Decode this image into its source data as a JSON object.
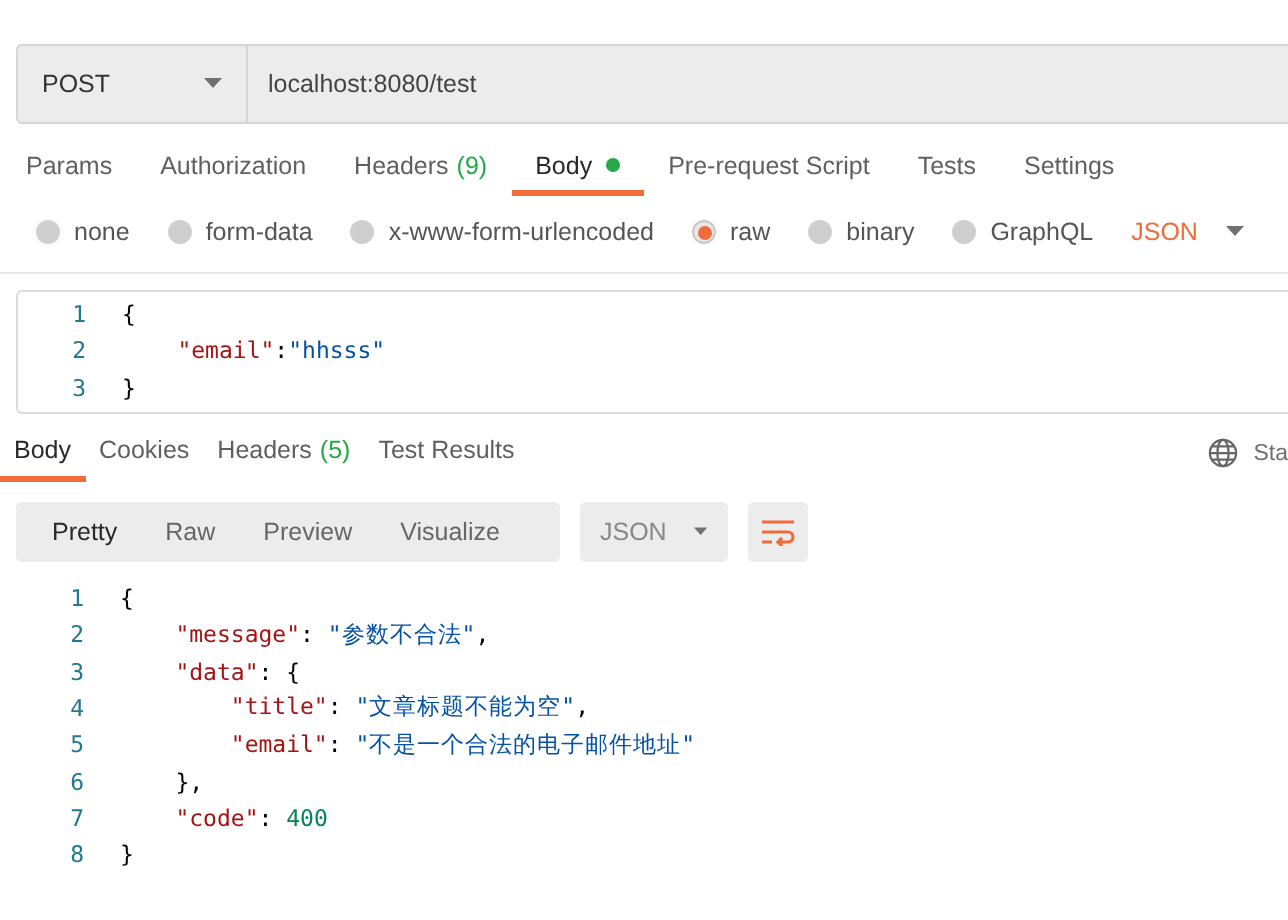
{
  "request": {
    "method": "POST",
    "url": "localhost:8080/test"
  },
  "request_tabs": [
    {
      "label": "Params",
      "selected": false
    },
    {
      "label": "Authorization",
      "selected": false
    },
    {
      "label": "Headers",
      "count": "(9)",
      "selected": false
    },
    {
      "label": "Body",
      "dot": true,
      "selected": true
    },
    {
      "label": "Pre-request Script",
      "selected": false
    },
    {
      "label": "Tests",
      "selected": false
    },
    {
      "label": "Settings",
      "selected": false
    }
  ],
  "body_types": [
    {
      "label": "none",
      "selected": false
    },
    {
      "label": "form-data",
      "selected": false
    },
    {
      "label": "x-www-form-urlencoded",
      "selected": false
    },
    {
      "label": "raw",
      "selected": true
    },
    {
      "label": "binary",
      "selected": false
    },
    {
      "label": "GraphQL",
      "selected": false
    }
  ],
  "raw_format": "JSON",
  "request_body": [
    {
      "number": "1",
      "tokens": [
        {
          "kind": "punct",
          "text": "{"
        }
      ]
    },
    {
      "number": "2",
      "kind": "inner",
      "tokens": [
        {
          "kind": "key",
          "text": "\"email\""
        },
        {
          "kind": "punct",
          "text": ":"
        },
        {
          "kind": "string",
          "text": "\"hhsss\""
        }
      ]
    },
    {
      "number": "3",
      "tokens": [
        {
          "kind": "punct",
          "text": "}"
        }
      ]
    }
  ],
  "response_tabs": [
    {
      "label": "Body",
      "selected": true
    },
    {
      "label": "Cookies",
      "selected": false
    },
    {
      "label": "Headers",
      "count": "(5)",
      "selected": false
    },
    {
      "label": "Test Results",
      "selected": false
    }
  ],
  "response_status_label": "Sta",
  "view_modes": [
    {
      "label": "Pretty",
      "selected": true
    },
    {
      "label": "Raw",
      "selected": false
    },
    {
      "label": "Preview",
      "selected": false
    },
    {
      "label": "Visualize",
      "selected": false
    }
  ],
  "response_format": "JSON",
  "response_body": [
    {
      "number": "1",
      "tokens": [
        {
          "kind": "punct",
          "text": "{"
        }
      ]
    },
    {
      "number": "2",
      "kind": "inner",
      "tokens": [
        {
          "kind": "key",
          "text": "\"message\""
        },
        {
          "kind": "punct",
          "text": ": "
        },
        {
          "kind": "string",
          "text": "\"参数不合法\""
        },
        {
          "kind": "punct",
          "text": ","
        }
      ]
    },
    {
      "number": "3",
      "kind": "inner",
      "tokens": [
        {
          "kind": "key",
          "text": "\"data\""
        },
        {
          "kind": "punct",
          "text": ": {"
        }
      ]
    },
    {
      "number": "4",
      "kind": "deep",
      "tokens": [
        {
          "kind": "key",
          "text": "\"title\""
        },
        {
          "kind": "punct",
          "text": ": "
        },
        {
          "kind": "string",
          "text": "\"文章标题不能为空\""
        },
        {
          "kind": "punct",
          "text": ","
        }
      ]
    },
    {
      "number": "5",
      "kind": "deep",
      "tokens": [
        {
          "kind": "key",
          "text": "\"email\""
        },
        {
          "kind": "punct",
          "text": ": "
        },
        {
          "kind": "string",
          "text": "\"不是一个合法的电子邮件地址\""
        }
      ]
    },
    {
      "number": "6",
      "kind": "inner",
      "tokens": [
        {
          "kind": "punct",
          "text": "},"
        }
      ]
    },
    {
      "number": "7",
      "kind": "inner",
      "tokens": [
        {
          "kind": "key",
          "text": "\"code\""
        },
        {
          "kind": "punct",
          "text": ": "
        },
        {
          "kind": "number",
          "text": "400"
        }
      ]
    },
    {
      "number": "8",
      "tokens": [
        {
          "kind": "punct",
          "text": "}"
        }
      ]
    }
  ]
}
